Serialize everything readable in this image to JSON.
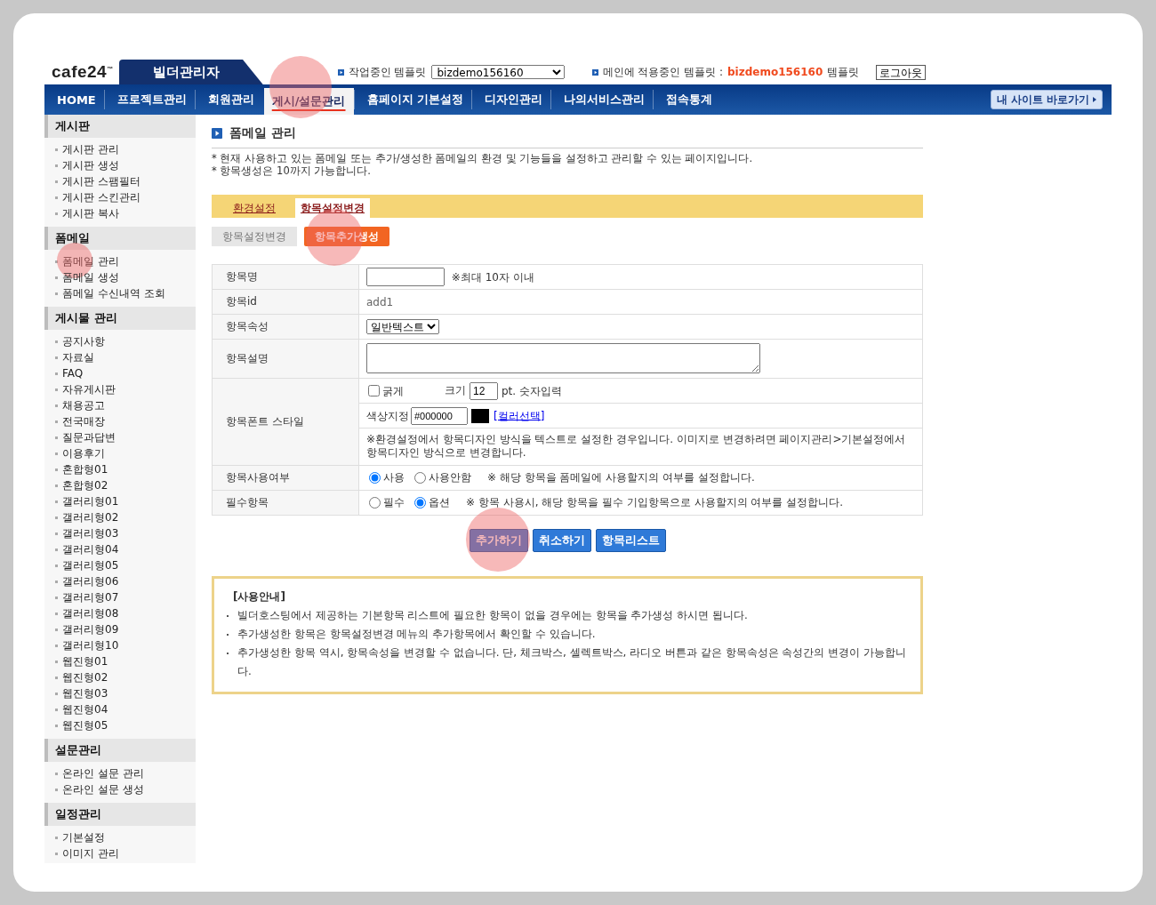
{
  "header": {
    "logo": "cafe24",
    "logo_mark": "™",
    "product": "빌더관리자",
    "working_label": "작업중인 템플릿",
    "working_value": "bizdemo156160",
    "applied_label": "메인에 적용중인 템플릿 :",
    "applied_value": "bizdemo156160",
    "applied_suffix": "템플릿",
    "logout": "로그아웃"
  },
  "nav": {
    "items": [
      {
        "label": "HOME",
        "selected": false,
        "highlighted": false
      },
      {
        "label": "프로젝트관리",
        "selected": false,
        "highlighted": false
      },
      {
        "label": "회원관리",
        "selected": false,
        "highlighted": false
      },
      {
        "label": "게시/설문관리",
        "selected": true,
        "highlighted": true
      },
      {
        "label": "홈페이지 기본설정",
        "selected": false,
        "highlighted": false
      },
      {
        "label": "디자인관리",
        "selected": false,
        "highlighted": false
      },
      {
        "label": "나의서비스관리",
        "selected": false,
        "highlighted": false
      },
      {
        "label": "접속통계",
        "selected": false,
        "highlighted": false
      }
    ],
    "site_button": "내 사이트 바로가기"
  },
  "sidebar": {
    "groups": [
      {
        "title": "게시판",
        "items": [
          {
            "label": "게시판 관리",
            "highlighted": false
          },
          {
            "label": "게시판 생성",
            "highlighted": false
          },
          {
            "label": "게시판 스팸필터",
            "highlighted": false
          },
          {
            "label": "게시판 스킨관리",
            "highlighted": false
          },
          {
            "label": "게시판 복사",
            "highlighted": false
          }
        ]
      },
      {
        "title": "폼메일",
        "items": [
          {
            "label": "폼메일 관리",
            "highlighted": true
          },
          {
            "label": "폼메일 생성",
            "highlighted": false
          },
          {
            "label": "폼메일 수신내역 조회",
            "highlighted": false
          }
        ]
      },
      {
        "title": "게시물 관리",
        "items": [
          {
            "label": "공지사항",
            "highlighted": false
          },
          {
            "label": "자료실",
            "highlighted": false
          },
          {
            "label": "FAQ",
            "highlighted": false
          },
          {
            "label": "자유게시판",
            "highlighted": false
          },
          {
            "label": "채용공고",
            "highlighted": false
          },
          {
            "label": "전국매장",
            "highlighted": false
          },
          {
            "label": "질문과답변",
            "highlighted": false
          },
          {
            "label": "이용후기",
            "highlighted": false
          },
          {
            "label": "혼합형01",
            "highlighted": false
          },
          {
            "label": "혼합형02",
            "highlighted": false
          },
          {
            "label": "갤러리형01",
            "highlighted": false
          },
          {
            "label": "갤러리형02",
            "highlighted": false
          },
          {
            "label": "갤러리형03",
            "highlighted": false
          },
          {
            "label": "갤러리형04",
            "highlighted": false
          },
          {
            "label": "갤러리형05",
            "highlighted": false
          },
          {
            "label": "갤러리형06",
            "highlighted": false
          },
          {
            "label": "갤러리형07",
            "highlighted": false
          },
          {
            "label": "갤러리형08",
            "highlighted": false
          },
          {
            "label": "갤러리형09",
            "highlighted": false
          },
          {
            "label": "갤러리형10",
            "highlighted": false
          },
          {
            "label": "웹진형01",
            "highlighted": false
          },
          {
            "label": "웹진형02",
            "highlighted": false
          },
          {
            "label": "웹진형03",
            "highlighted": false
          },
          {
            "label": "웹진형04",
            "highlighted": false
          },
          {
            "label": "웹진형05",
            "highlighted": false
          }
        ]
      },
      {
        "title": "설문관리",
        "items": [
          {
            "label": "온라인 설문 관리",
            "highlighted": false
          },
          {
            "label": "온라인 설문 생성",
            "highlighted": false
          }
        ]
      },
      {
        "title": "일정관리",
        "items": [
          {
            "label": "기본설정",
            "highlighted": false
          },
          {
            "label": "이미지 관리",
            "highlighted": false
          }
        ]
      }
    ]
  },
  "page": {
    "title": "폼메일 관리",
    "notes": [
      "* 현재 사용하고 있는 폼메일 또는 추가/생성한 폼메일의 환경 및 기능들을 설정하고 관리할 수 있는 페이지입니다.",
      "* 항목생성은 10까지 가능합니다."
    ],
    "tabs": [
      {
        "label": "환경설정",
        "selected": false
      },
      {
        "label": "항목설정변경",
        "selected": true
      }
    ],
    "subtabs": [
      {
        "label": "항목설정변경",
        "selected": false,
        "highlighted": false
      },
      {
        "label": "항목추가생성",
        "selected": true,
        "highlighted": true
      }
    ],
    "form": [
      {
        "kind": "text_input",
        "label": "항목명",
        "hint": "※최대 10자 이내"
      },
      {
        "kind": "static",
        "label": "항목id",
        "value": "add1"
      },
      {
        "kind": "select",
        "label": "항목속성",
        "value": "일반텍스트"
      },
      {
        "kind": "textarea",
        "label": "항목설명"
      },
      {
        "kind": "font_style",
        "label": "항목폰트 스타일",
        "bold_label": "굵게",
        "bold_checked": false,
        "size_label": "크기",
        "size_value": "12",
        "size_unit": "pt. 숫자입력",
        "color_label": "색상지정",
        "color_value": "#000000",
        "color_link": "[컬러선택]",
        "note": "※환경설정에서 항목디자인 방식을 텍스트로 설정한 경우입니다. 이미지로 변경하려면 페이지관리>기본설정에서 항목디자인 방식으로 변경합니다."
      },
      {
        "kind": "radio",
        "label": "항목사용여부",
        "options": [
          {
            "label": "사용",
            "selected": true
          },
          {
            "label": "사용안함",
            "selected": false
          }
        ],
        "note": "※ 해당 항목을 폼메일에 사용할지의 여부를 설정합니다."
      },
      {
        "kind": "radio",
        "label": "필수항목",
        "options": [
          {
            "label": "필수",
            "selected": false
          },
          {
            "label": "옵션",
            "selected": true
          }
        ],
        "note": "※ 항목 사용시, 해당 항목을 필수 기입항목으로 사용할지의 여부를 설정합니다."
      }
    ],
    "buttons": [
      {
        "label": "추가하기",
        "highlighted": true
      },
      {
        "label": "취소하기",
        "highlighted": false
      },
      {
        "label": "항목리스트",
        "highlighted": false
      }
    ],
    "guide": {
      "title": "[사용안내]",
      "items": [
        "빌더호스팅에서 제공하는 기본항목 리스트에 필요한 항목이 없을 경우에는 항목을 추가생성 하시면 됩니다.",
        "추가생성한 항목은 항목설정변경 메뉴의 추가항목에서 확인할 수 있습니다.",
        "추가생성한 항목 역시, 항목속성을 변경할 수 없습니다. 단, 체크박스, 셀렉트박스, 라디오 버튼과 같은 항목속성은 속성간의 변경이 가능합니다."
      ]
    }
  }
}
